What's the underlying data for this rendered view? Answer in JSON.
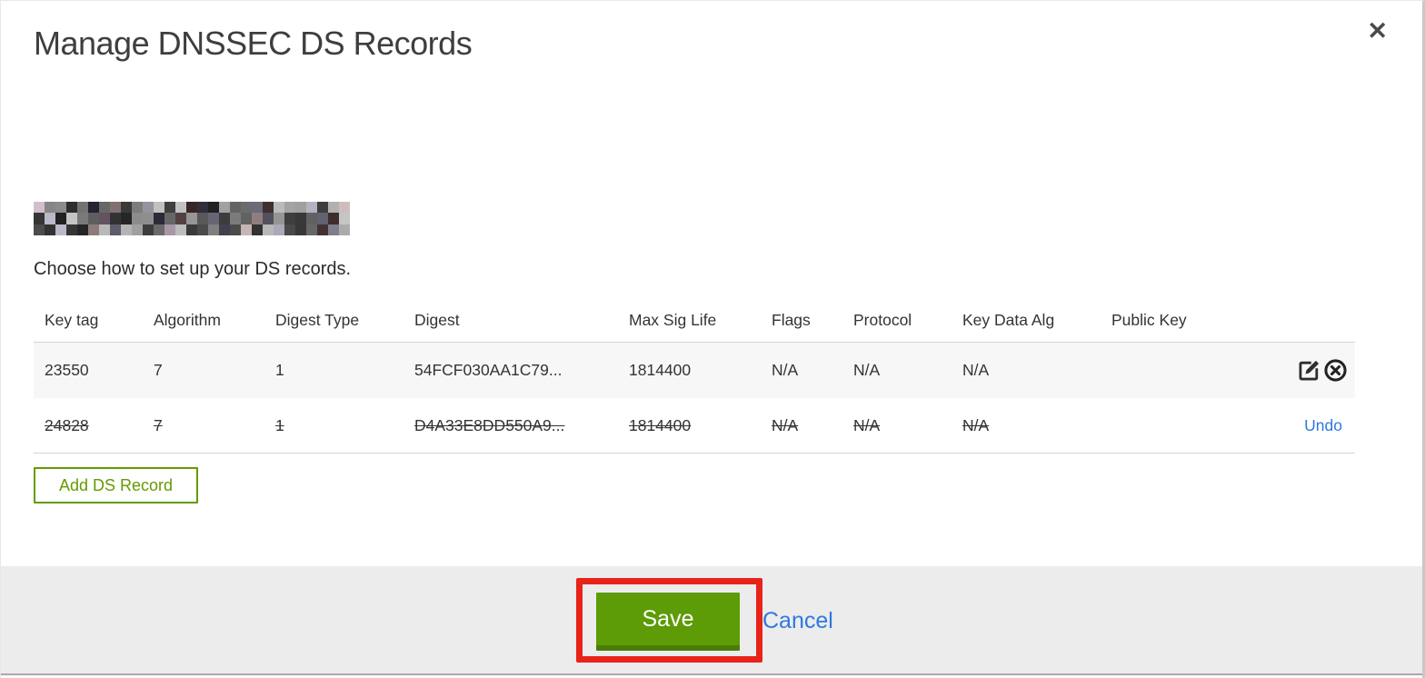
{
  "modal": {
    "title": "Manage DNSSEC DS Records",
    "close_icon": "✕",
    "domain_redacted": true,
    "subtitle": "Choose how to set up your DS records."
  },
  "table": {
    "headers": [
      "Key tag",
      "Algorithm",
      "Digest Type",
      "Digest",
      "Max Sig Life",
      "Flags",
      "Protocol",
      "Key Data Alg",
      "Public Key"
    ],
    "rows": [
      {
        "key_tag": "23550",
        "algorithm": "7",
        "digest_type": "1",
        "digest": "54FCF030AA1C79...",
        "max_sig_life": "1814400",
        "flags": "N/A",
        "protocol": "N/A",
        "key_data_alg": "N/A",
        "public_key": "",
        "state": "normal",
        "action_icons": [
          "edit-icon",
          "delete-icon"
        ]
      },
      {
        "key_tag": "24828",
        "algorithm": "7",
        "digest_type": "1",
        "digest": "D4A33E8DD550A9...",
        "max_sig_life": "1814400",
        "flags": "N/A",
        "protocol": "N/A",
        "key_data_alg": "N/A",
        "public_key": "",
        "state": "deleted",
        "undo_label": "Undo"
      }
    ]
  },
  "buttons": {
    "add_record": "Add DS Record",
    "save": "Save",
    "cancel": "Cancel"
  },
  "colors": {
    "accent-green": "#5d9b07",
    "accent-green-dark": "#4a7d05",
    "outline-green": "#649b00",
    "link-blue": "#2d79e0",
    "annotation-red": "#e8231a",
    "row-alt-bg": "#f7f7f7",
    "footer-bg": "#ececec"
  }
}
